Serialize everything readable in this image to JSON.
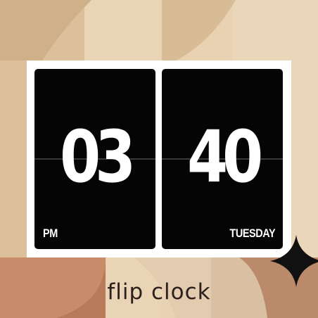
{
  "clock": {
    "hours": "03",
    "minutes": "40",
    "meridiem": "PM",
    "weekday": "TUESDAY"
  },
  "caption": "flip clock",
  "colors": {
    "card": "#050505",
    "frame": "#ffffff",
    "digit": "#ffffff",
    "caption": "#2b201b",
    "background_light": "#e6cfaf",
    "background_terracotta": "#c98c6a"
  },
  "decor": {
    "sparkle_icon": "four-point-star-icon"
  }
}
